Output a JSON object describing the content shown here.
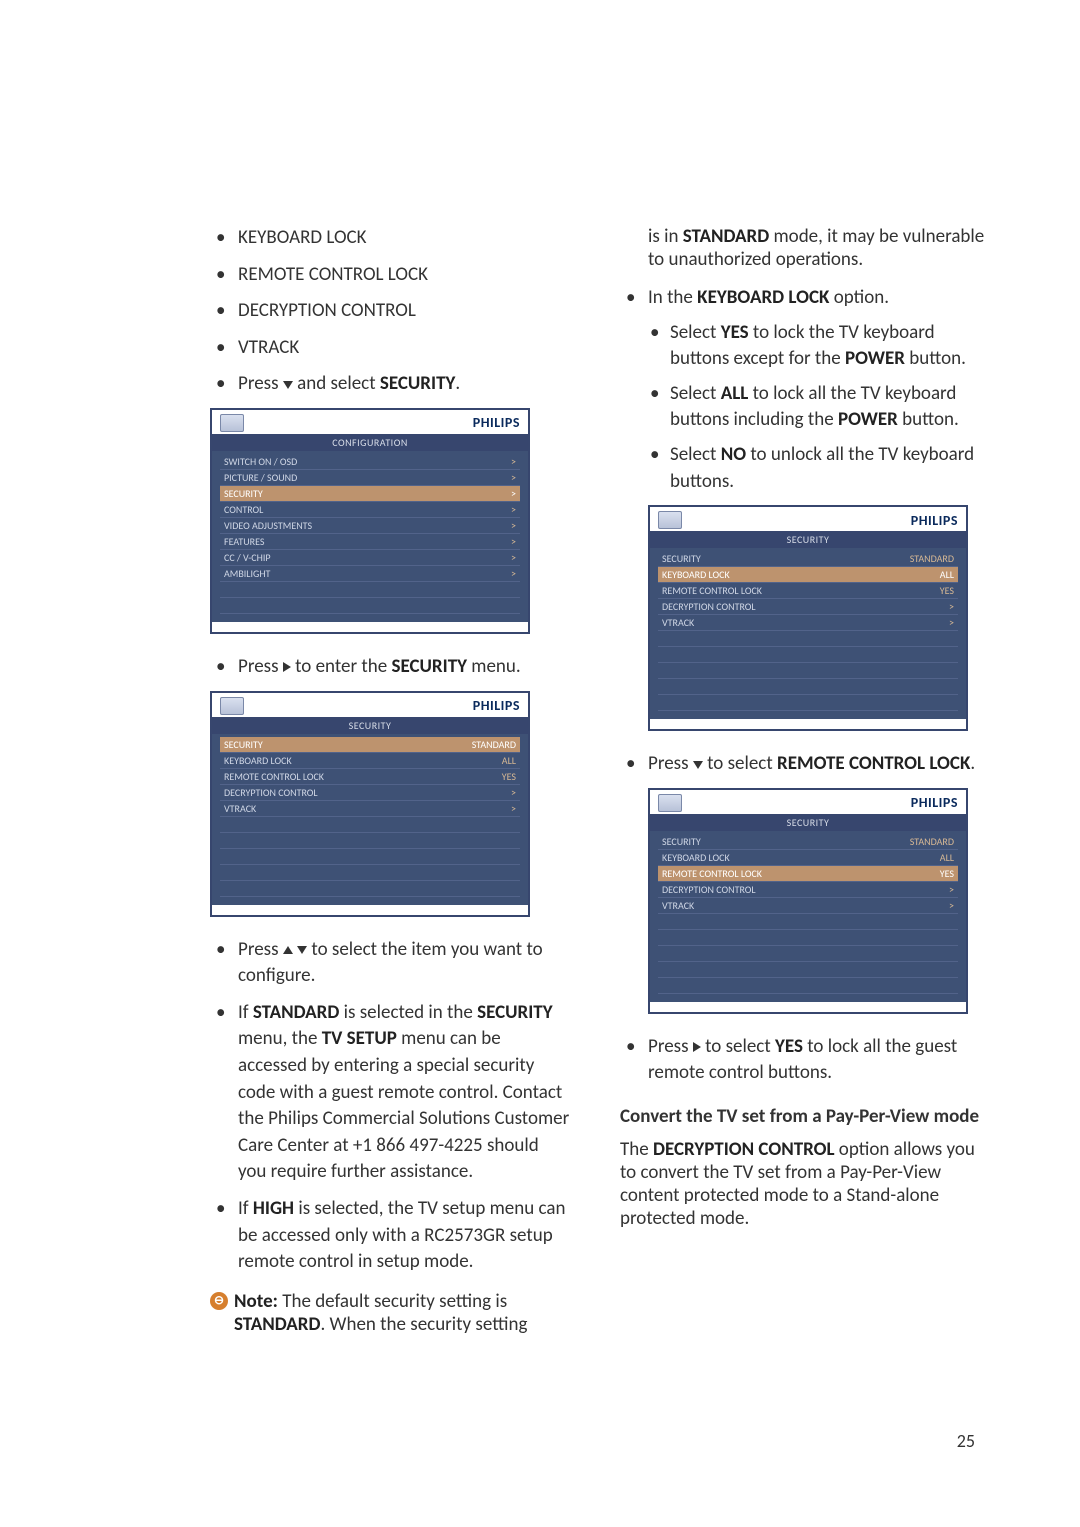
{
  "page_number": "25",
  "left": {
    "items": [
      "KEYBOARD LOCK",
      "REMOTE CONTROL LOCK",
      "DECRYPTION CONTROL",
      "VTRACK"
    ],
    "press_down_prefix": "Press ",
    "press_down_mid": " and select ",
    "press_down_target": "SECURITY",
    "press_down_suffix": ".",
    "osd1": {
      "logo": "PHILIPS",
      "title": "CONFIGURATION",
      "rows": [
        {
          "label": "SWITCH ON / OSD",
          "val": ">"
        },
        {
          "label": "PICTURE / SOUND",
          "val": ">"
        },
        {
          "label": "SECURITY",
          "val": ">",
          "hl": true
        },
        {
          "label": "CONTROL",
          "val": ">"
        },
        {
          "label": "VIDEO ADJUSTMENTS",
          "val": ">"
        },
        {
          "label": "FEATURES",
          "val": ">"
        },
        {
          "label": "CC / V-CHIP",
          "val": ">"
        },
        {
          "label": "AMBILIGHT",
          "val": ">"
        },
        {
          "label": "",
          "val": ""
        },
        {
          "label": "",
          "val": ""
        }
      ]
    },
    "press_right_prefix": "Press ",
    "press_right_mid": " to enter the ",
    "press_right_target": "SECURITY",
    "press_right_suffix": " menu.",
    "osd2": {
      "logo": "PHILIPS",
      "title": "SECURITY",
      "rows": [
        {
          "label": "SECURITY",
          "val": "STANDARD",
          "hl": true
        },
        {
          "label": "KEYBOARD LOCK",
          "val": "ALL"
        },
        {
          "label": "REMOTE CONTROL LOCK",
          "val": "YES"
        },
        {
          "label": "DECRYPTION CONTROL",
          "val": ">"
        },
        {
          "label": "VTRACK",
          "val": ">"
        },
        {
          "label": "",
          "val": ""
        },
        {
          "label": "",
          "val": ""
        },
        {
          "label": "",
          "val": ""
        },
        {
          "label": "",
          "val": ""
        },
        {
          "label": "",
          "val": ""
        }
      ]
    },
    "press_updown_prefix": "Press ",
    "press_updown_suffix": " to select the item you want to configure.",
    "standard_p1_a": "If ",
    "standard_p1_b": "STANDARD",
    "standard_p1_c": " is selected in the ",
    "standard_p1_d": "SECURITY",
    "standard_p1_e": " menu, the ",
    "standard_p1_f": "TV SETUP",
    "standard_p1_g": " menu can be accessed by entering a special security code with a guest remote control. Contact the Philips Commercial Solutions Customer Care Center at +1 866 497-4225 should you require further assistance.",
    "high_a": "If ",
    "high_b": "HIGH",
    "high_c": " is selected, the TV setup menu can be accessed only with a RC2573GR setup remote control in setup mode.",
    "note_label": "Note:",
    "note_a": " The default security setting is ",
    "note_b": "STANDARD",
    "note_c": ". When the security setting"
  },
  "right": {
    "cont_a": "is in ",
    "cont_b": "STANDARD",
    "cont_c": " mode, it may be vulnerable to unauthorized operations.",
    "kbd_a": "In the ",
    "kbd_b": "KEYBOARD LOCK",
    "kbd_c": " option.",
    "yes_a": "Select ",
    "yes_b": "YES",
    "yes_c": " to lock the TV keyboard buttons except for the ",
    "yes_d": "POWER",
    "yes_e": " button.",
    "all_a": "Select ",
    "all_b": "ALL",
    "all_c": " to lock all the TV keyboard buttons including the ",
    "all_d": "POWER",
    "all_e": " button.",
    "no_a": "Select ",
    "no_b": "NO",
    "no_c": " to unlock all the TV keyboard buttons.",
    "osd3": {
      "logo": "PHILIPS",
      "title": "SECURITY",
      "rows": [
        {
          "label": "SECURITY",
          "val": "STANDARD"
        },
        {
          "label": "KEYBOARD LOCK",
          "val": "ALL",
          "hl": true
        },
        {
          "label": "REMOTE CONTROL LOCK",
          "val": "YES"
        },
        {
          "label": "DECRYPTION CONTROL",
          "val": ">"
        },
        {
          "label": "VTRACK",
          "val": ">"
        },
        {
          "label": "",
          "val": ""
        },
        {
          "label": "",
          "val": ""
        },
        {
          "label": "",
          "val": ""
        },
        {
          "label": "",
          "val": ""
        },
        {
          "label": "",
          "val": ""
        }
      ]
    },
    "press_down2_prefix": "Press ",
    "press_down2_mid": " to select ",
    "press_down2_target": "REMOTE CONTROL LOCK",
    "press_down2_suffix": ".",
    "osd4": {
      "logo": "PHILIPS",
      "title": "SECURITY",
      "rows": [
        {
          "label": "SECURITY",
          "val": "STANDARD"
        },
        {
          "label": "KEYBOARD LOCK",
          "val": "ALL"
        },
        {
          "label": "REMOTE CONTROL LOCK",
          "val": "YES",
          "hl": true
        },
        {
          "label": "DECRYPTION CONTROL",
          "val": ">"
        },
        {
          "label": "VTRACK",
          "val": ">"
        },
        {
          "label": "",
          "val": ""
        },
        {
          "label": "",
          "val": ""
        },
        {
          "label": "",
          "val": ""
        },
        {
          "label": "",
          "val": ""
        },
        {
          "label": "",
          "val": ""
        }
      ]
    },
    "press_right2_prefix": "Press ",
    "press_right2_mid": " to select ",
    "press_right2_target": "YES",
    "press_right2_suffix": " to lock all the guest remote control buttons.",
    "section": "Convert the TV set from a Pay-Per-View mode",
    "dec_a": "The ",
    "dec_b": "DECRYPTION CONTROL",
    "dec_c": " option allows you to convert the TV set from a Pay-Per-View content protected mode to a Stand-alone protected mode."
  }
}
